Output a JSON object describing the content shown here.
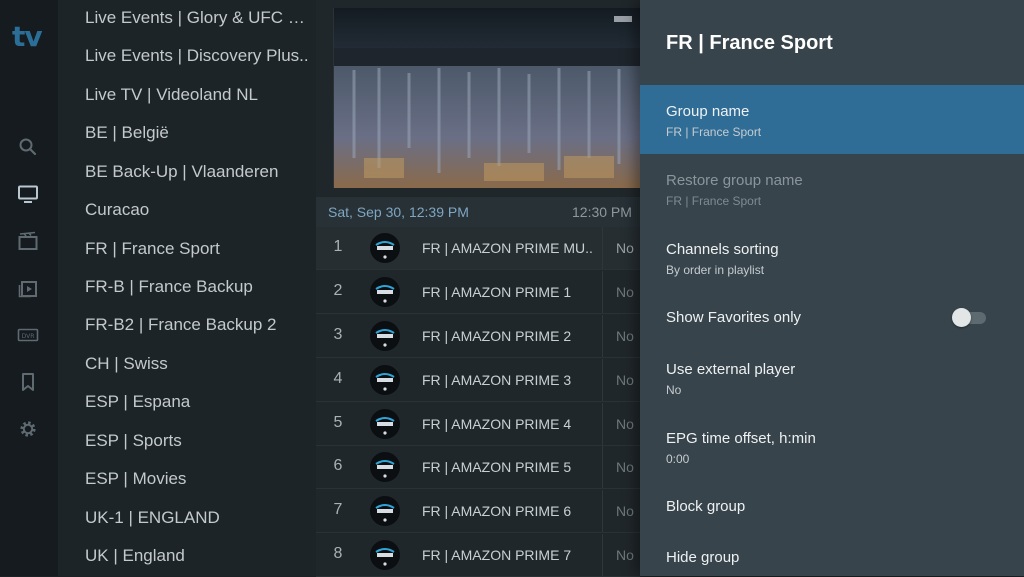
{
  "app": {
    "logo_text": "tv",
    "accent_color": "#2f6c96"
  },
  "rail": {
    "icons": [
      "search-icon",
      "tv-icon",
      "movies-icon",
      "series-icon",
      "dvr-icon",
      "bookmark-icon",
      "gear-icon"
    ],
    "dvr_label": "DVR"
  },
  "groups": [
    "Live Events | Glory & UFC an..",
    "Live Events | Discovery Plus..",
    "Live TV | Videoland NL",
    "BE | België",
    "BE Back-Up | Vlaanderen",
    "Curacao",
    "FR | France Sport",
    "FR-B | France Backup",
    "FR-B2 | France Backup 2",
    "CH | Swiss",
    "ESP | Espana",
    "ESP | Sports",
    "ESP | Movies",
    "UK-1 | ENGLAND",
    "UK | England"
  ],
  "epg": {
    "date": "Sat, Sep 30, 12:39 PM",
    "time": "12:30 PM"
  },
  "channels": [
    {
      "num": "1",
      "name": "FR | AMAZON PRIME MU..",
      "program": "No"
    },
    {
      "num": "2",
      "name": "FR | AMAZON PRIME 1",
      "program": "No"
    },
    {
      "num": "3",
      "name": "FR | AMAZON PRIME 2",
      "program": "No"
    },
    {
      "num": "4",
      "name": "FR | AMAZON PRIME 3",
      "program": "No"
    },
    {
      "num": "5",
      "name": "FR | AMAZON PRIME 4",
      "program": "No"
    },
    {
      "num": "6",
      "name": "FR | AMAZON PRIME 5",
      "program": "No"
    },
    {
      "num": "7",
      "name": "FR | AMAZON PRIME 6",
      "program": "No"
    },
    {
      "num": "8",
      "name": "FR | AMAZON PRIME 7",
      "program": "No"
    }
  ],
  "panel": {
    "title": "FR | France Sport",
    "options": [
      {
        "label": "Group name",
        "value": "FR | France Sport",
        "state": "selected"
      },
      {
        "label": "Restore group name",
        "value": "FR | France Sport",
        "state": "disabled"
      },
      {
        "label": "Channels sorting",
        "value": "By order in playlist",
        "state": "normal"
      },
      {
        "label": "Show Favorites only",
        "value": "",
        "state": "toggle",
        "toggle_on": false
      },
      {
        "label": "Use external player",
        "value": "No",
        "state": "normal"
      },
      {
        "label": "EPG time offset, h:min",
        "value": "0:00",
        "state": "normal"
      },
      {
        "label": "Block group",
        "value": "",
        "state": "normal"
      },
      {
        "label": "Hide group",
        "value": "",
        "state": "normal"
      }
    ]
  }
}
